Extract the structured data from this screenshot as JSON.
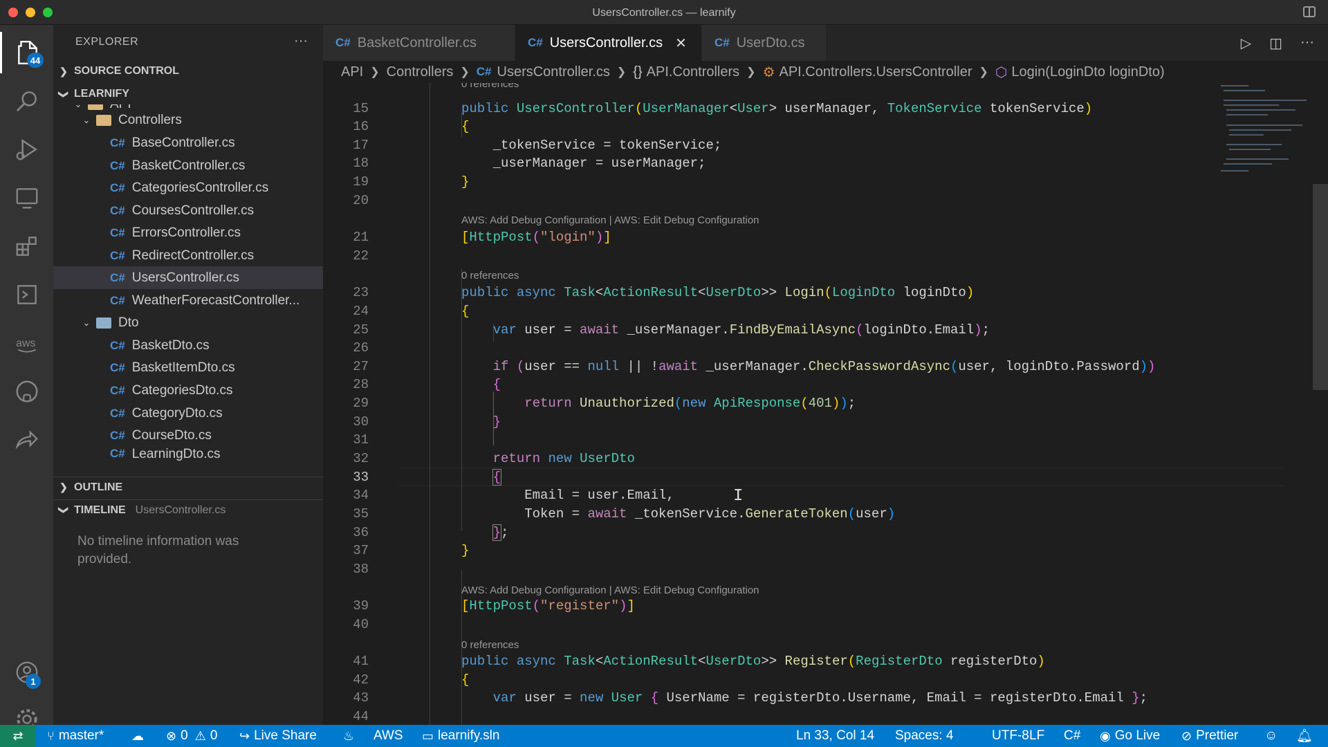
{
  "window": {
    "title": "UsersController.cs — learnify"
  },
  "activity": {
    "explorer_badge": "44",
    "accounts_badge": "1"
  },
  "sidebar": {
    "header": "EXPLORER",
    "more": "···",
    "source_control": "SOURCE CONTROL",
    "project": "LEARNIFY",
    "tree": [
      {
        "label": "API",
        "kind": "folder"
      },
      {
        "label": "Controllers",
        "kind": "folder"
      },
      {
        "label": "BaseController.cs",
        "kind": "cs"
      },
      {
        "label": "BasketController.cs",
        "kind": "cs"
      },
      {
        "label": "CategoriesController.cs",
        "kind": "cs"
      },
      {
        "label": "CoursesController.cs",
        "kind": "cs"
      },
      {
        "label": "ErrorsController.cs",
        "kind": "cs"
      },
      {
        "label": "RedirectController.cs",
        "kind": "cs"
      },
      {
        "label": "UsersController.cs",
        "kind": "cs"
      },
      {
        "label": "WeatherForecastController...",
        "kind": "cs"
      },
      {
        "label": "Dto",
        "kind": "folder"
      },
      {
        "label": "BasketDto.cs",
        "kind": "cs"
      },
      {
        "label": "BasketItemDto.cs",
        "kind": "cs"
      },
      {
        "label": "CategoriesDto.cs",
        "kind": "cs"
      },
      {
        "label": "CategoryDto.cs",
        "kind": "cs"
      },
      {
        "label": "CourseDto.cs",
        "kind": "cs"
      },
      {
        "label": "LearningDto.cs",
        "kind": "cs"
      }
    ],
    "outline": "OUTLINE",
    "timeline": "TIMELINE",
    "timeline_file": "UsersController.cs",
    "timeline_empty": "No timeline information was provided."
  },
  "tabs": [
    {
      "label": "BasketController.cs",
      "icon": "C#"
    },
    {
      "label": "UsersController.cs",
      "icon": "C#",
      "close": "✕"
    },
    {
      "label": "UserDto.cs",
      "icon": "C#"
    }
  ],
  "breadcrumb": {
    "api": "API",
    "controllers": "Controllers",
    "file": "UsersController.cs",
    "namespace": "API.Controllers",
    "class": "API.Controllers.UsersController",
    "method": "Login(LoginDto loginDto)"
  },
  "editor": {
    "lens_refs": "0 references",
    "lens_aws": "AWS: Add Debug Configuration | AWS: Edit Debug Configuration",
    "line_numbers": [
      "15",
      "16",
      "17",
      "18",
      "19",
      "20",
      "21",
      "22",
      "23",
      "24",
      "25",
      "26",
      "27",
      "28",
      "29",
      "30",
      "31",
      "32",
      "33",
      "34",
      "35",
      "36",
      "37",
      "38",
      "39",
      "40",
      "41",
      "42",
      "43",
      "44"
    ]
  },
  "status": {
    "branch": "master*",
    "errors": "0",
    "warnings": "0",
    "live_share": "Live Share",
    "aws": "AWS",
    "solution": "learnify.sln",
    "position": "Ln 33, Col 14",
    "spaces": "Spaces: 4",
    "encoding": "UTF-8",
    "eol": "LF",
    "language": "C#",
    "go_live": "Go Live",
    "prettier": "Prettier"
  }
}
